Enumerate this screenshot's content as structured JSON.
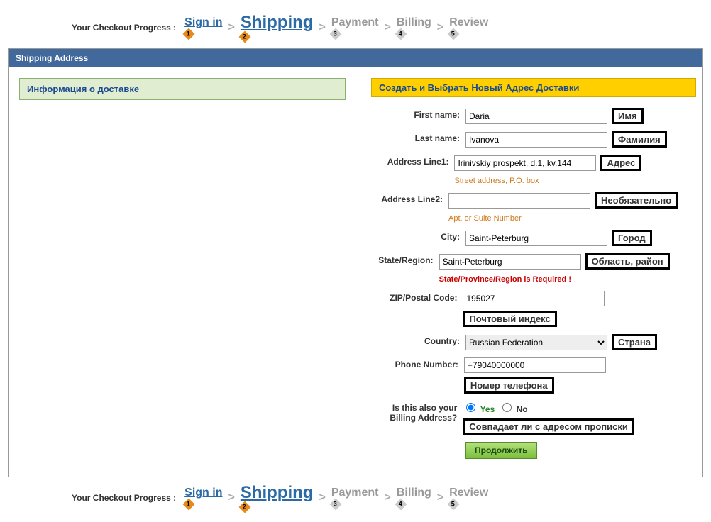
{
  "progress": {
    "label": "Your Checkout Progress :",
    "steps": [
      {
        "label": "Sign in",
        "num": "1"
      },
      {
        "label": "Shipping",
        "num": "2"
      },
      {
        "label": "Payment",
        "num": "3"
      },
      {
        "label": "Billing",
        "num": "4"
      },
      {
        "label": "Review",
        "num": "5"
      }
    ]
  },
  "panel": {
    "title": "Shipping Address",
    "infoBox": "Информация о доставке",
    "createBox": "Создать и Выбрать Новый Адрес Доставки"
  },
  "form": {
    "firstName": {
      "label": "First name:",
      "value": "Daria",
      "anno": "Имя"
    },
    "lastName": {
      "label": "Last name:",
      "value": "Ivanova",
      "anno": "Фамилия"
    },
    "addr1": {
      "label": "Address Line1:",
      "value": "Irinivskiy prospekt, d.1, kv.144",
      "hint": "Street address, P.O. box",
      "anno": "Адрес"
    },
    "addr2": {
      "label": "Address Line2:",
      "value": "",
      "hint": "Apt. or Suite Number",
      "anno": "Необязательно"
    },
    "city": {
      "label": "City:",
      "value": "Saint-Peterburg",
      "anno": "Город"
    },
    "state": {
      "label": "State/Region:",
      "value": "Saint-Peterburg",
      "error": "State/Province/Region is Required !",
      "anno": "Область, район"
    },
    "zip": {
      "label": "ZIP/Postal Code:",
      "value": "195027",
      "anno": "Почтовый индекс"
    },
    "country": {
      "label": "Country:",
      "value": "Russian Federation",
      "anno": "Страна"
    },
    "phone": {
      "label": "Phone Number:",
      "value": "+79040000000",
      "anno": "Номер телефона"
    },
    "billing": {
      "label": "Is this also your Billing Address?",
      "yes": "Yes",
      "no": "No",
      "anno": "Совпадает ли с адресом прописки"
    },
    "continue": "Продолжить"
  }
}
